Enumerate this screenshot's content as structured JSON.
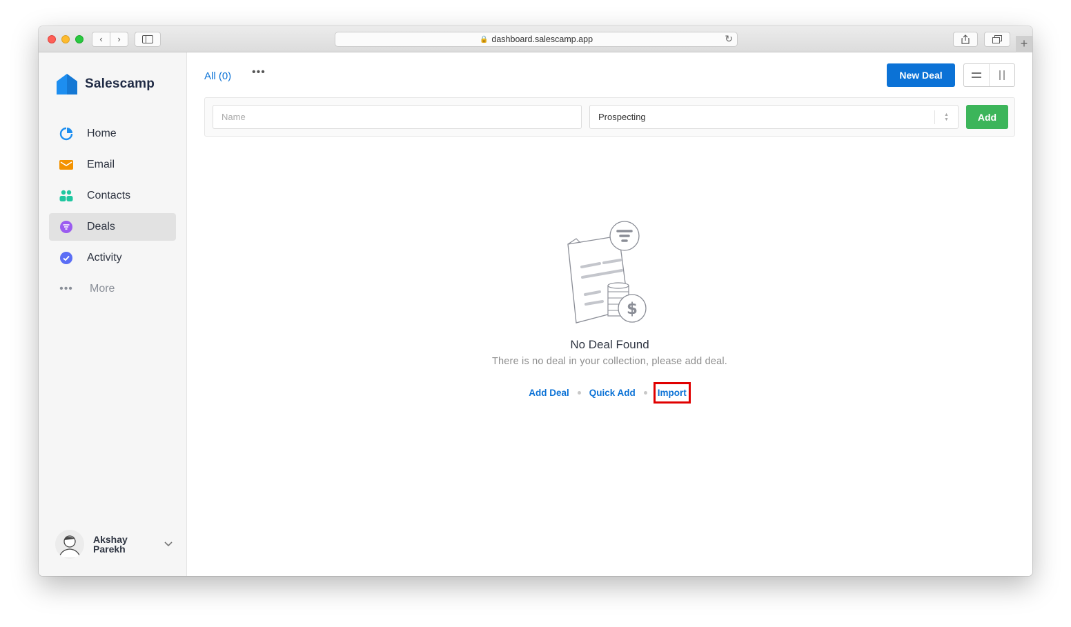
{
  "browser": {
    "url": "dashboard.salescamp.app",
    "nav_back": "‹",
    "nav_forward": "›",
    "new_tab": "+"
  },
  "brand": {
    "name": "Salescamp",
    "color": "#1d8ef0"
  },
  "sidebar": {
    "items": [
      {
        "label": "Home",
        "icon": "pie-chart-icon",
        "color": "#1d8ef0"
      },
      {
        "label": "Email",
        "icon": "envelope-icon",
        "color": "#f39200"
      },
      {
        "label": "Contacts",
        "icon": "people-icon",
        "color": "#1fc7a0"
      },
      {
        "label": "Deals",
        "icon": "filter-circle-icon",
        "color": "#9b5cf0",
        "active": true
      },
      {
        "label": "Activity",
        "icon": "check-circle-icon",
        "color": "#5b6ef5"
      }
    ],
    "more_label": "More",
    "more_icon": "•••"
  },
  "user": {
    "first_name": "Akshay",
    "last_name": "Parekh",
    "chevron": "⌄"
  },
  "header": {
    "filter_tab": "All (0)",
    "more_dots": "•••",
    "new_deal_label": "New Deal",
    "accent_color": "#0b72d6"
  },
  "quick_form": {
    "name_placeholder": "Name",
    "stage_value": "Prospecting",
    "add_label": "Add",
    "add_color": "#3cb55a"
  },
  "empty_state": {
    "title": "No Deal Found",
    "subtitle": "There is no deal in your collection, please add deal.",
    "actions": [
      "Add Deal",
      "Quick Add",
      "Import"
    ],
    "highlighted_action": "Import"
  }
}
